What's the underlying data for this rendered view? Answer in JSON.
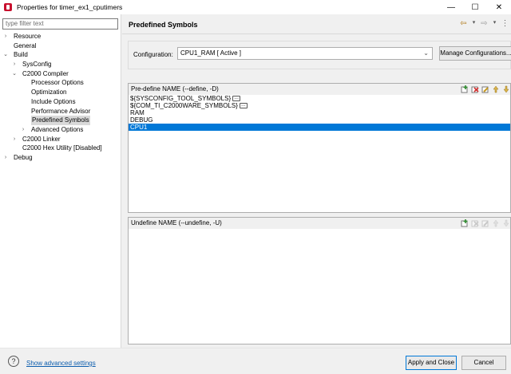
{
  "window": {
    "title": "Properties for timer_ex1_cputimers",
    "controls": [
      "—",
      "☐",
      "✕"
    ]
  },
  "sidebar": {
    "filter_placeholder": "type filter text",
    "tree": [
      {
        "label": "Resource",
        "level": 0,
        "twisty": "closed"
      },
      {
        "label": "General",
        "level": 0,
        "twisty": "none"
      },
      {
        "label": "Build",
        "level": 0,
        "twisty": "open"
      },
      {
        "label": "SysConfig",
        "level": 1,
        "twisty": "closed"
      },
      {
        "label": "C2000 Compiler",
        "level": 1,
        "twisty": "open"
      },
      {
        "label": "Processor Options",
        "level": 2,
        "twisty": "none"
      },
      {
        "label": "Optimization",
        "level": 2,
        "twisty": "none"
      },
      {
        "label": "Include Options",
        "level": 2,
        "twisty": "none"
      },
      {
        "label": "Performance Advisor",
        "level": 2,
        "twisty": "none"
      },
      {
        "label": "Predefined Symbols",
        "level": 2,
        "twisty": "none",
        "selected": true
      },
      {
        "label": "Advanced Options",
        "level": 2,
        "twisty": "closed"
      },
      {
        "label": "C2000 Linker",
        "level": 1,
        "twisty": "closed"
      },
      {
        "label": "C2000 Hex Utility  [Disabled]",
        "level": 1,
        "twisty": "none"
      },
      {
        "label": "Debug",
        "level": 0,
        "twisty": "closed"
      }
    ]
  },
  "main": {
    "title": "Predefined Symbols",
    "config_label": "Configuration:",
    "config_value": "CPU1_RAM  [ Active ]",
    "manage_button": "Manage Configurations...",
    "predefine": {
      "header": "Pre-define NAME (--define, -D)",
      "rows": [
        {
          "text": "${SYSCONFIG_TOOL_SYMBOLS}",
          "more": true
        },
        {
          "text": "${COM_TI_C2000WARE_SYMBOLS}",
          "more": true
        },
        {
          "text": "RAM",
          "more": false
        },
        {
          "text": "DEBUG",
          "more": false
        },
        {
          "text": "CPU1",
          "more": false,
          "selected": true
        }
      ]
    },
    "undefine": {
      "header": "Undefine NAME (--undefine, -U)",
      "rows": []
    }
  },
  "footer": {
    "advanced_link": "Show advanced settings",
    "apply_close": "Apply and Close",
    "cancel": "Cancel"
  },
  "colors": {
    "selection": "#0078d7",
    "link": "#0b5cad",
    "app_icon": "#c8102e"
  }
}
